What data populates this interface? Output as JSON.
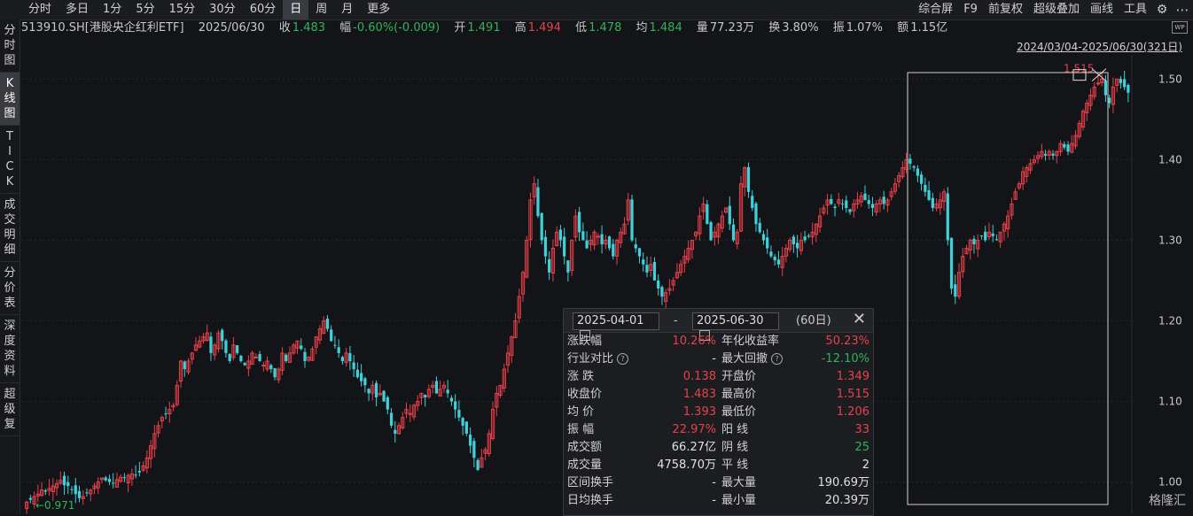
{
  "tabs": [
    "分时",
    "多日",
    "1分",
    "5分",
    "15分",
    "30分",
    "60分",
    "日",
    "周",
    "月",
    "更多"
  ],
  "active_tab": "日",
  "right_tools": [
    "综合屏",
    "F9",
    "前复权",
    "超级叠加",
    "画线",
    "工具"
  ],
  "side_tabs": [
    {
      "label": "分时图",
      "active": false
    },
    {
      "label": "K线图",
      "active": true
    },
    {
      "label": "TICK",
      "active": false
    },
    {
      "label": "成交明细",
      "active": false
    },
    {
      "label": "分价表",
      "active": false
    },
    {
      "label": "深度资料",
      "active": false
    },
    {
      "label": "超级复",
      "active": false
    }
  ],
  "info": {
    "code": "513910.SH[港股央企红利ETF]",
    "date": "2025/06/30",
    "close_label": "收",
    "close": "1.483",
    "chg_label": "幅",
    "chg": "-0.60%(-0.009)",
    "open_label": "开",
    "open": "1.491",
    "high_label": "高",
    "high": "1.494",
    "low_label": "低",
    "low": "1.478",
    "avg_label": "均",
    "avg": "1.484",
    "vol_label": "量",
    "vol": "77.23万",
    "turn_label": "换",
    "turn": "3.80%",
    "amp_label": "振",
    "amp": "1.07%",
    "amt_label": "额",
    "amt": "1.15亿"
  },
  "range_label": "2024/03/04-2025/06/30(321日)",
  "wp_icon": "WP",
  "chart_data": {
    "type": "candlestick",
    "ylim": [
      0.96,
      1.53
    ],
    "yticks": [
      "1.50",
      "1.40",
      "1.30",
      "1.20",
      "1.10",
      "1.00"
    ],
    "low_marker": "0.971",
    "high_marker": "1.515",
    "closes": [
      0.975,
      0.978,
      0.982,
      0.985,
      0.99,
      0.988,
      0.992,
      0.995,
      0.998,
      1.002,
      0.996,
      0.995,
      0.99,
      0.985,
      0.98,
      0.982,
      0.986,
      0.99,
      0.995,
      1.0,
      1.005,
      1.002,
      1.0,
      0.998,
      1.003,
      1.006,
      1.005,
      1.008,
      1.01,
      1.008,
      1.012,
      1.02,
      1.03,
      1.045,
      1.06,
      1.07,
      1.08,
      1.085,
      1.09,
      1.095,
      1.12,
      1.15,
      1.14,
      1.15,
      1.16,
      1.17,
      1.175,
      1.18,
      1.185,
      1.16,
      1.17,
      1.185,
      1.175,
      1.16,
      1.15,
      1.17,
      1.16,
      1.15,
      1.145,
      1.15,
      1.16,
      1.155,
      1.15,
      1.145,
      1.15,
      1.14,
      1.13,
      1.14,
      1.16,
      1.15,
      1.16,
      1.17,
      1.175,
      1.165,
      1.15,
      1.155,
      1.165,
      1.18,
      1.19,
      1.2,
      1.19,
      1.175,
      1.17,
      1.16,
      1.15,
      1.16,
      1.15,
      1.14,
      1.13,
      1.125,
      1.12,
      1.11,
      1.12,
      1.105,
      1.11,
      1.1,
      1.09,
      1.07,
      1.06,
      1.07,
      1.08,
      1.09,
      1.085,
      1.095,
      1.1,
      1.11,
      1.105,
      1.115,
      1.12,
      1.11,
      1.115,
      1.12,
      1.11,
      1.1,
      1.09,
      1.08,
      1.07,
      1.06,
      1.045,
      1.03,
      1.015,
      1.03,
      1.04,
      1.06,
      1.09,
      1.11,
      1.12,
      1.14,
      1.16,
      1.18,
      1.2,
      1.23,
      1.26,
      1.3,
      1.35,
      1.37,
      1.33,
      1.3,
      1.28,
      1.26,
      1.29,
      1.31,
      1.3,
      1.28,
      1.26,
      1.3,
      1.33,
      1.31,
      1.3,
      1.29,
      1.3,
      1.31,
      1.305,
      1.295,
      1.3,
      1.29,
      1.28,
      1.3,
      1.31,
      1.32,
      1.35,
      1.3,
      1.29,
      1.28,
      1.27,
      1.26,
      1.27,
      1.25,
      1.24,
      1.23,
      1.235,
      1.24,
      1.25,
      1.26,
      1.27,
      1.28,
      1.29,
      1.3,
      1.31,
      1.33,
      1.345,
      1.32,
      1.3,
      1.31,
      1.32,
      1.33,
      1.34,
      1.32,
      1.3,
      1.31,
      1.37,
      1.39,
      1.36,
      1.34,
      1.32,
      1.31,
      1.3,
      1.29,
      1.28,
      1.275,
      1.27,
      1.28,
      1.29,
      1.3,
      1.295,
      1.29,
      1.3,
      1.3,
      1.305,
      1.31,
      1.32,
      1.33,
      1.34,
      1.35,
      1.345,
      1.34,
      1.35,
      1.345,
      1.34,
      1.335,
      1.345,
      1.35,
      1.355,
      1.35,
      1.345,
      1.34,
      1.345,
      1.35,
      1.345,
      1.35,
      1.36,
      1.37,
      1.38,
      1.39,
      1.4,
      1.395,
      1.39,
      1.38,
      1.37,
      1.36,
      1.35,
      1.34,
      1.345,
      1.35,
      1.36,
      1.3,
      1.24,
      1.23,
      1.26,
      1.28,
      1.29,
      1.3,
      1.295,
      1.3,
      1.305,
      1.3,
      1.31,
      1.305,
      1.3,
      1.31,
      1.32,
      1.33,
      1.345,
      1.36,
      1.37,
      1.385,
      1.39,
      1.395,
      1.4,
      1.405,
      1.41,
      1.405,
      1.41,
      1.405,
      1.41,
      1.42,
      1.415,
      1.41,
      1.42,
      1.43,
      1.445,
      1.46,
      1.47,
      1.48,
      1.49,
      1.495,
      1.5,
      1.48,
      1.47,
      1.49,
      1.5,
      1.495,
      1.49,
      1.483
    ],
    "volumes": []
  },
  "panel": {
    "start_date": "2025-04-01",
    "dash": "-",
    "end_date": "2025-06-30",
    "days": "(60日)",
    "rows": [
      {
        "l1": "涨跌幅",
        "v1": "10.26%",
        "c1": "red",
        "l2": "年化收益率",
        "v2": "50.23%",
        "c2": "red"
      },
      {
        "l1": "行业对比",
        "q1": true,
        "v1": "-",
        "c1": "white",
        "l2": "最大回撤",
        "q2": true,
        "v2": "-12.10%",
        "c2": "green"
      },
      {
        "l1": "涨  跌",
        "v1": "0.138",
        "c1": "red",
        "l2": "开盘价",
        "v2": "1.349",
        "c2": "red"
      },
      {
        "l1": "收盘价",
        "v1": "1.483",
        "c1": "red",
        "l2": "最高价",
        "v2": "1.515",
        "c2": "red"
      },
      {
        "l1": "均  价",
        "v1": "1.393",
        "c1": "red",
        "l2": "最低价",
        "v2": "1.206",
        "c2": "red"
      },
      {
        "l1": "振  幅",
        "v1": "22.97%",
        "c1": "red",
        "l2": "阳  线",
        "v2": "33",
        "c2": "red"
      },
      {
        "l1": "成交额",
        "v1": "66.27亿",
        "c1": "white",
        "l2": "阴  线",
        "v2": "25",
        "c2": "green"
      },
      {
        "l1": "成交量",
        "v1": "4758.70万",
        "c1": "white",
        "l2": "平  线",
        "v2": "2",
        "c2": "white"
      },
      {
        "l1": "区间换手",
        "v1": "-",
        "c1": "white",
        "l2": "最大量",
        "v2": "190.69万",
        "c2": "white"
      },
      {
        "l1": "日均换手",
        "v1": "-",
        "c1": "white",
        "l2": "最小量",
        "v2": "20.39万",
        "c2": "white"
      }
    ]
  },
  "logo": "格隆汇",
  "colors": {
    "up": "#e8404a",
    "down": "#3fd0d8",
    "bg": "#131417"
  }
}
